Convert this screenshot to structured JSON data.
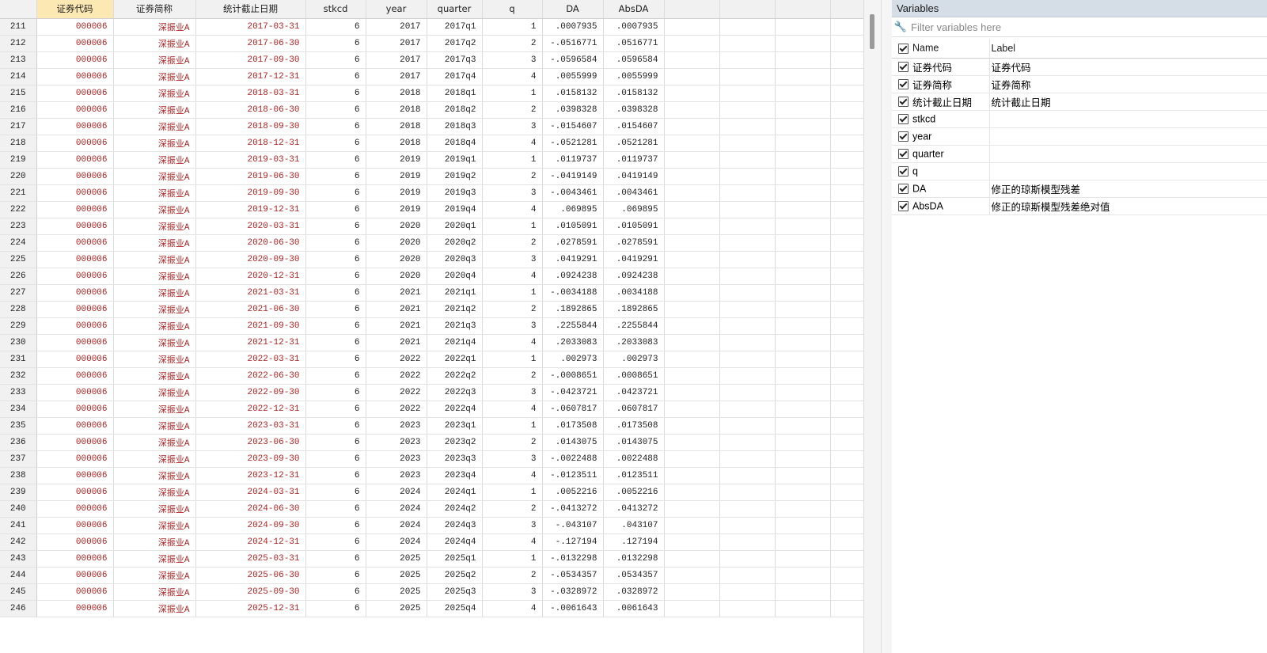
{
  "grid": {
    "columns": [
      {
        "label": "证券代码",
        "selected": true
      },
      {
        "label": "证券简称",
        "selected": false
      },
      {
        "label": "统计截止日期",
        "selected": false
      },
      {
        "label": "stkcd",
        "selected": false
      },
      {
        "label": "year",
        "selected": false
      },
      {
        "label": "quarter",
        "selected": false
      },
      {
        "label": "q",
        "selected": false
      },
      {
        "label": "DA",
        "selected": false
      },
      {
        "label": "AbsDA",
        "selected": false
      }
    ],
    "rows": [
      [
        "211",
        "000006",
        "深振业A",
        "2017-03-31",
        "6",
        "2017",
        "2017q1",
        "1",
        ".0007935",
        ".0007935"
      ],
      [
        "212",
        "000006",
        "深振业A",
        "2017-06-30",
        "6",
        "2017",
        "2017q2",
        "2",
        "-.0516771",
        ".0516771"
      ],
      [
        "213",
        "000006",
        "深振业A",
        "2017-09-30",
        "6",
        "2017",
        "2017q3",
        "3",
        "-.0596584",
        ".0596584"
      ],
      [
        "214",
        "000006",
        "深振业A",
        "2017-12-31",
        "6",
        "2017",
        "2017q4",
        "4",
        ".0055999",
        ".0055999"
      ],
      [
        "215",
        "000006",
        "深振业A",
        "2018-03-31",
        "6",
        "2018",
        "2018q1",
        "1",
        ".0158132",
        ".0158132"
      ],
      [
        "216",
        "000006",
        "深振业A",
        "2018-06-30",
        "6",
        "2018",
        "2018q2",
        "2",
        ".0398328",
        ".0398328"
      ],
      [
        "217",
        "000006",
        "深振业A",
        "2018-09-30",
        "6",
        "2018",
        "2018q3",
        "3",
        "-.0154607",
        ".0154607"
      ],
      [
        "218",
        "000006",
        "深振业A",
        "2018-12-31",
        "6",
        "2018",
        "2018q4",
        "4",
        "-.0521281",
        ".0521281"
      ],
      [
        "219",
        "000006",
        "深振业A",
        "2019-03-31",
        "6",
        "2019",
        "2019q1",
        "1",
        ".0119737",
        ".0119737"
      ],
      [
        "220",
        "000006",
        "深振业A",
        "2019-06-30",
        "6",
        "2019",
        "2019q2",
        "2",
        "-.0419149",
        ".0419149"
      ],
      [
        "221",
        "000006",
        "深振业A",
        "2019-09-30",
        "6",
        "2019",
        "2019q3",
        "3",
        "-.0043461",
        ".0043461"
      ],
      [
        "222",
        "000006",
        "深振业A",
        "2019-12-31",
        "6",
        "2019",
        "2019q4",
        "4",
        ".069895",
        ".069895"
      ],
      [
        "223",
        "000006",
        "深振业A",
        "2020-03-31",
        "6",
        "2020",
        "2020q1",
        "1",
        ".0105091",
        ".0105091"
      ],
      [
        "224",
        "000006",
        "深振业A",
        "2020-06-30",
        "6",
        "2020",
        "2020q2",
        "2",
        ".0278591",
        ".0278591"
      ],
      [
        "225",
        "000006",
        "深振业A",
        "2020-09-30",
        "6",
        "2020",
        "2020q3",
        "3",
        ".0419291",
        ".0419291"
      ],
      [
        "226",
        "000006",
        "深振业A",
        "2020-12-31",
        "6",
        "2020",
        "2020q4",
        "4",
        ".0924238",
        ".0924238"
      ],
      [
        "227",
        "000006",
        "深振业A",
        "2021-03-31",
        "6",
        "2021",
        "2021q1",
        "1",
        "-.0034188",
        ".0034188"
      ],
      [
        "228",
        "000006",
        "深振业A",
        "2021-06-30",
        "6",
        "2021",
        "2021q2",
        "2",
        ".1892865",
        ".1892865"
      ],
      [
        "229",
        "000006",
        "深振业A",
        "2021-09-30",
        "6",
        "2021",
        "2021q3",
        "3",
        ".2255844",
        ".2255844"
      ],
      [
        "230",
        "000006",
        "深振业A",
        "2021-12-31",
        "6",
        "2021",
        "2021q4",
        "4",
        ".2033083",
        ".2033083"
      ],
      [
        "231",
        "000006",
        "深振业A",
        "2022-03-31",
        "6",
        "2022",
        "2022q1",
        "1",
        ".002973",
        ".002973"
      ],
      [
        "232",
        "000006",
        "深振业A",
        "2022-06-30",
        "6",
        "2022",
        "2022q2",
        "2",
        "-.0008651",
        ".0008651"
      ],
      [
        "233",
        "000006",
        "深振业A",
        "2022-09-30",
        "6",
        "2022",
        "2022q3",
        "3",
        "-.0423721",
        ".0423721"
      ],
      [
        "234",
        "000006",
        "深振业A",
        "2022-12-31",
        "6",
        "2022",
        "2022q4",
        "4",
        "-.0607817",
        ".0607817"
      ],
      [
        "235",
        "000006",
        "深振业A",
        "2023-03-31",
        "6",
        "2023",
        "2023q1",
        "1",
        ".0173508",
        ".0173508"
      ],
      [
        "236",
        "000006",
        "深振业A",
        "2023-06-30",
        "6",
        "2023",
        "2023q2",
        "2",
        ".0143075",
        ".0143075"
      ],
      [
        "237",
        "000006",
        "深振业A",
        "2023-09-30",
        "6",
        "2023",
        "2023q3",
        "3",
        "-.0022488",
        ".0022488"
      ],
      [
        "238",
        "000006",
        "深振业A",
        "2023-12-31",
        "6",
        "2023",
        "2023q4",
        "4",
        "-.0123511",
        ".0123511"
      ],
      [
        "239",
        "000006",
        "深振业A",
        "2024-03-31",
        "6",
        "2024",
        "2024q1",
        "1",
        ".0052216",
        ".0052216"
      ],
      [
        "240",
        "000006",
        "深振业A",
        "2024-06-30",
        "6",
        "2024",
        "2024q2",
        "2",
        "-.0413272",
        ".0413272"
      ],
      [
        "241",
        "000006",
        "深振业A",
        "2024-09-30",
        "6",
        "2024",
        "2024q3",
        "3",
        "-.043107",
        ".043107"
      ],
      [
        "242",
        "000006",
        "深振业A",
        "2024-12-31",
        "6",
        "2024",
        "2024q4",
        "4",
        "-.127194",
        ".127194"
      ],
      [
        "243",
        "000006",
        "深振业A",
        "2025-03-31",
        "6",
        "2025",
        "2025q1",
        "1",
        "-.0132298",
        ".0132298"
      ],
      [
        "244",
        "000006",
        "深振业A",
        "2025-06-30",
        "6",
        "2025",
        "2025q2",
        "2",
        "-.0534357",
        ".0534357"
      ],
      [
        "245",
        "000006",
        "深振业A",
        "2025-09-30",
        "6",
        "2025",
        "2025q3",
        "3",
        "-.0328972",
        ".0328972"
      ],
      [
        "246",
        "000006",
        "深振业A",
        "2025-12-31",
        "6",
        "2025",
        "2025q4",
        "4",
        "-.0061643",
        ".0061643"
      ]
    ],
    "string_color": "#b22222",
    "selected_header_color": "#fbe8b2"
  },
  "variables": {
    "title": "Variables",
    "filter_placeholder": "Filter variables here",
    "filter_icon": "wrench-icon",
    "header": {
      "name": "Name",
      "label": "Label"
    },
    "items": [
      {
        "name": "证券代码",
        "label": "证券代码",
        "checked": true
      },
      {
        "name": "证券简称",
        "label": "证券简称",
        "checked": true
      },
      {
        "name": "统计截止日期",
        "label": "统计截止日期",
        "checked": true
      },
      {
        "name": "stkcd",
        "label": "",
        "checked": true
      },
      {
        "name": "year",
        "label": "",
        "checked": true
      },
      {
        "name": "quarter",
        "label": "",
        "checked": true
      },
      {
        "name": "q",
        "label": "",
        "checked": true
      },
      {
        "name": "DA",
        "label": "修正的琼斯模型残差",
        "checked": true
      },
      {
        "name": "AbsDA",
        "label": "修正的琼斯模型残差绝对值",
        "checked": true
      }
    ]
  }
}
